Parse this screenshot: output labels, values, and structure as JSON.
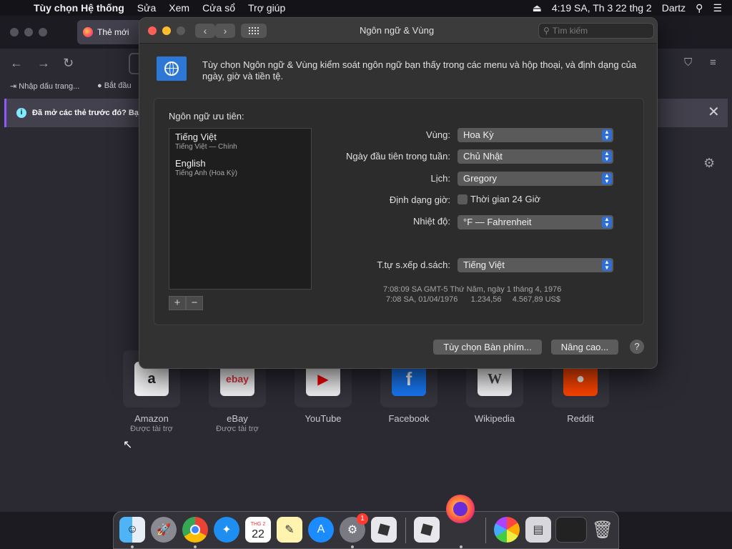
{
  "menubar": {
    "app_name": "Tùy chọn Hệ thống",
    "menus": [
      "Sửa",
      "Xem",
      "Cửa sổ",
      "Trợ giúp"
    ],
    "clock": "4:19 SA, Th 3 22 thg 2",
    "user": "Dartz"
  },
  "firefox": {
    "tab_title": "Thẻ mới",
    "bookmarks": [
      "Nhập dấu trang...",
      "Bắt đầu"
    ],
    "notice": "Đã mở các thẻ trước đó? Bạ",
    "sites": [
      {
        "name": "Amazon",
        "sub": "Được tài trợ",
        "glyph": "a"
      },
      {
        "name": "eBay",
        "sub": "Được tài trợ",
        "glyph": "ebay"
      },
      {
        "name": "YouTube",
        "sub": "",
        "glyph": "▶"
      },
      {
        "name": "Facebook",
        "sub": "",
        "glyph": "f"
      },
      {
        "name": "Wikipedia",
        "sub": "",
        "glyph": "W"
      },
      {
        "name": "Reddit",
        "sub": "",
        "glyph": "●"
      }
    ]
  },
  "prefs": {
    "title": "Ngôn ngữ & Vùng",
    "search_placeholder": "Tìm kiếm",
    "description": "Tùy chọn Ngôn ngữ & Vùng kiểm soát ngôn ngữ bạn thấy trong các menu và hộp thoại, và định dạng của ngày, giờ và tiền tệ.",
    "preferred_label": "Ngôn ngữ ưu tiên:",
    "languages": [
      {
        "name": "Tiếng Việt",
        "detail": "Tiếng Việt — Chính"
      },
      {
        "name": "English",
        "detail": "Tiếng Anh (Hoa Kỳ)"
      }
    ],
    "add_label": "+",
    "remove_label": "−",
    "rows": {
      "region_label": "Vùng:",
      "region_value": "Hoa Kỳ",
      "first_day_label": "Ngày đầu tiên trong tuần:",
      "first_day_value": "Chủ Nhật",
      "calendar_label": "Lịch:",
      "calendar_value": "Gregory",
      "time_format_label": "Định dạng giờ:",
      "time_24h_label": "Thời gian 24 Giờ",
      "time_24h_checked": false,
      "temperature_label": "Nhiệt độ:",
      "temperature_value": "°F — Fahrenheit",
      "sort_label": "T.tự s.xếp d.sách:",
      "sort_value": "Tiếng Việt"
    },
    "sample_line1": "7:08:09 SA GMT-5 Thứ Năm, ngày 1 tháng 4, 1976",
    "sample_line2": "7:08 SA, 01/04/1976      1.234,56     4.567,89 US$",
    "keyboard_button": "Tùy chọn Bàn phím...",
    "advanced_button": "Nâng cao...",
    "help_label": "?"
  },
  "dock": {
    "calendar_month": "THG 2",
    "calendar_day": "22",
    "badge_count": "1"
  },
  "colors": {
    "accent": "#2f6fd6",
    "close": "#ff5f57",
    "minimize": "#febc2e",
    "zoom_disabled": "#5a5a5a"
  }
}
